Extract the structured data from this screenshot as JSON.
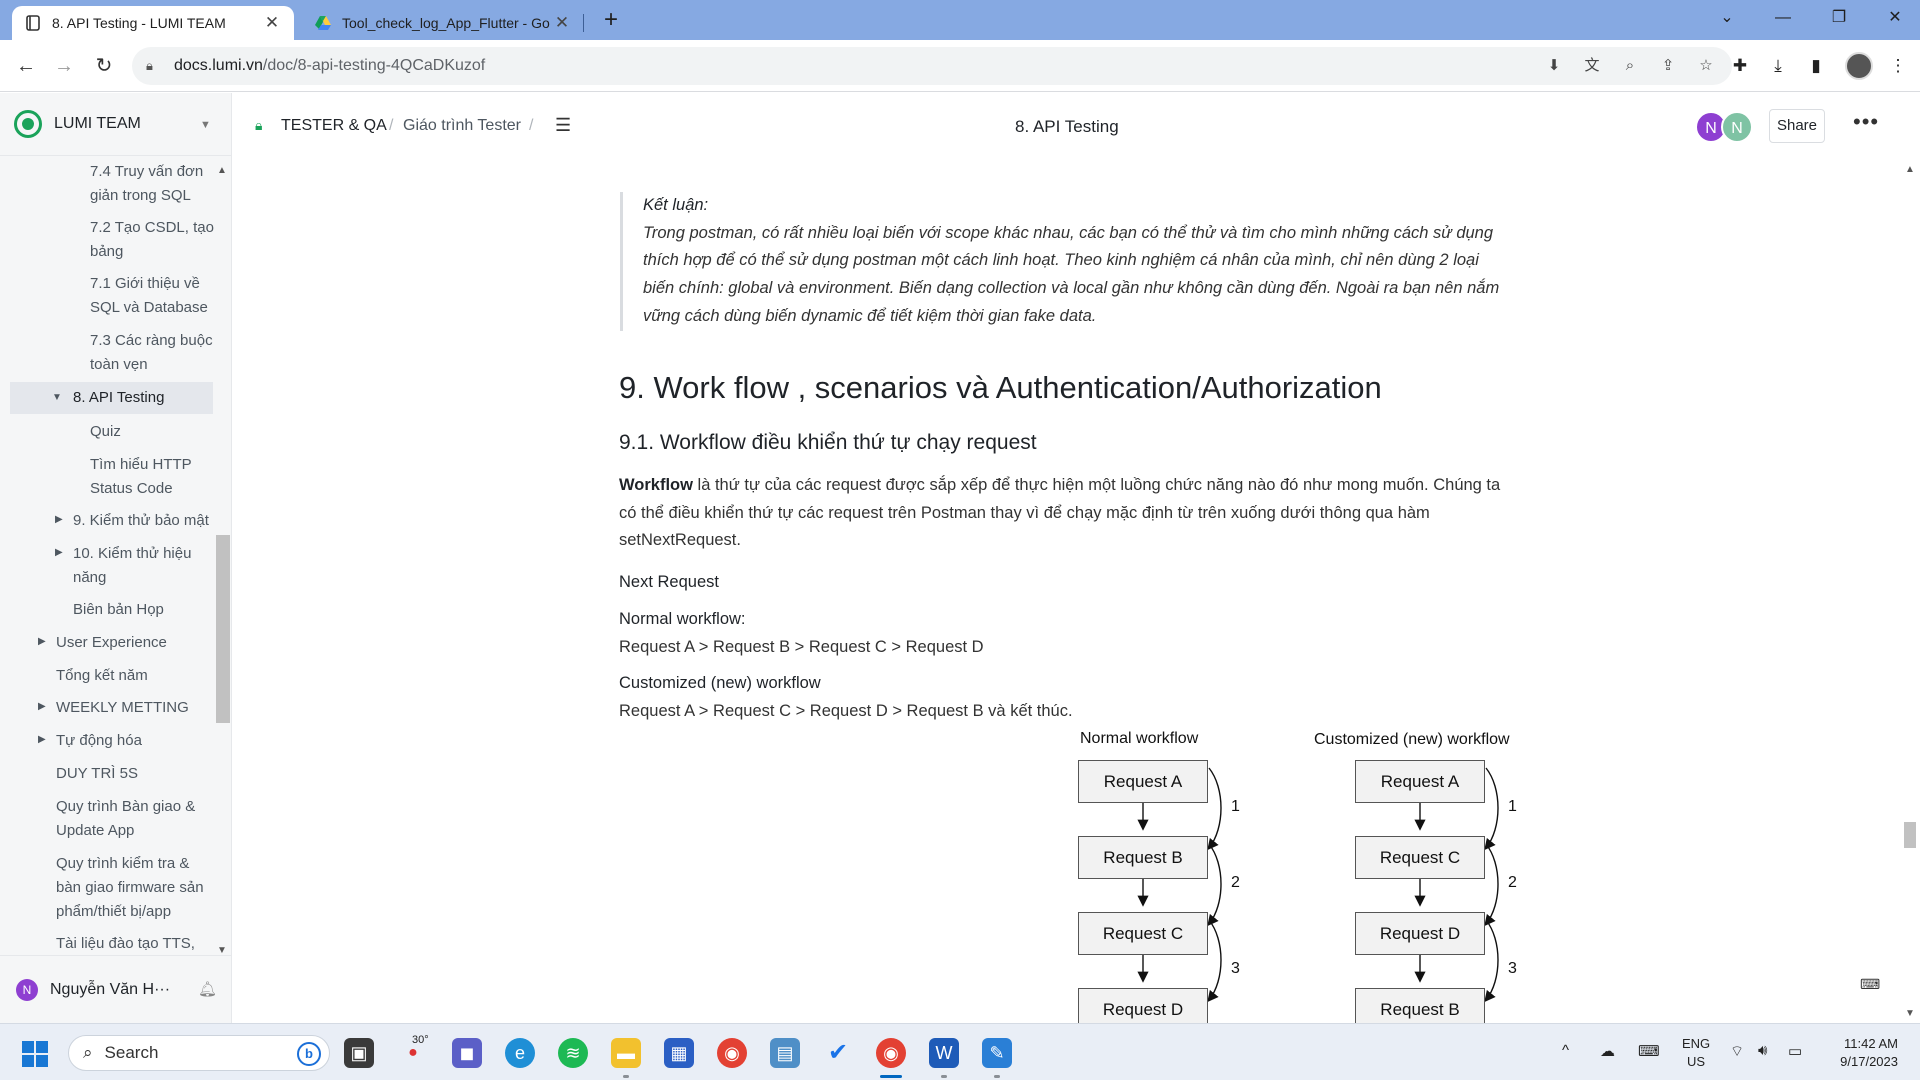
{
  "browser": {
    "tabs": [
      {
        "title": "8. API Testing - LUMI TEAM",
        "icon": "outline-doc-icon"
      },
      {
        "title": "Tool_check_log_App_Flutter - Go",
        "icon": "google-drive-icon"
      }
    ],
    "new_tab_label": "+",
    "url_host": "docs.lumi.vn",
    "url_path": "/doc/8-api-testing-4QCaDKuzof"
  },
  "sidebar": {
    "team_name": "LUMI TEAM",
    "items": [
      {
        "label": "7.4 Truy vấn đơn",
        "label2": "giản trong SQL"
      },
      {
        "label": "7.2 Tạo CSDL, tạo",
        "label2": "bảng"
      },
      {
        "label": "7.1 Giới thiệu về",
        "label2": "SQL và Database"
      },
      {
        "label": "7.3 Các ràng buộc",
        "label2": "toàn vẹn"
      },
      {
        "label": "8. API Testing"
      },
      {
        "label": "Quiz"
      },
      {
        "label": "Tìm hiểu HTTP",
        "label2": "Status Code"
      },
      {
        "label": "9. Kiểm thử bảo mật"
      },
      {
        "label": "10. Kiểm thử hiệu",
        "label2": "năng"
      },
      {
        "label": "Biên bản Họp"
      },
      {
        "label": "User Experience"
      },
      {
        "label": "Tổng kết năm"
      },
      {
        "label": "WEEKLY METTING"
      },
      {
        "label": "Tự động hóa"
      },
      {
        "label": "DUY TRÌ 5S"
      },
      {
        "label": "Quy trình Bàn giao &",
        "label2": "Update App"
      },
      {
        "label": "Quy trình kiểm tra &",
        "label2": "bàn giao firmware sản",
        "label3": "phẩm/thiết bị/app"
      },
      {
        "label": "Tài liệu đào tạo TTS,"
      }
    ],
    "user_initial": "N",
    "user_name": "Nguyễn Văn H···"
  },
  "header": {
    "breadcrumb_1": "TESTER & QA",
    "breadcrumb_2": "Giáo trình Tester",
    "title": "8. API Testing",
    "avatar_1": "N",
    "avatar_2": "N",
    "avatar_1_color": "#8e3fd1",
    "avatar_2_color": "#7fc3a4",
    "share_label": "Share",
    "more_label": "···"
  },
  "content": {
    "quote_title": "Kết luận:",
    "quote_body": "Trong postman, có rất nhiều loại biến với scope khác nhau, các bạn có thể thử và tìm cho mình những cách sử dụng thích hợp để có thể sử dụng postman một cách linh hoạt. Theo kinh nghiệm cá nhân của mình, chỉ nên dùng 2 loại biến chính: global và environment. Biến dạng collection và local gần như không cần dùng đến. Ngoài ra bạn nên nắm vững cách dùng biến dynamic để tiết kiệm thời gian fake data.",
    "h2": "9. Work flow , scenarios và Authentication/Authorization",
    "h3": "9.1. Workflow điều khiển thứ tự chạy request",
    "para_bold": "Workflow",
    "para_rest": " là thứ tự của các request được sắp xếp để thực hiện một luồng chức năng nào đó như mong muốn. Chúng ta có thể điều khiển thứ tự các request trên Postman thay vì để chạy mặc định từ trên xuống dưới thông qua hàm setNextRequest.",
    "next_request": "Next Request",
    "normal_label": "Normal workflow:",
    "normal_flow": "Request A > Request B > Request C > Request D",
    "custom_label": "Customized (new) workflow",
    "custom_flow": "Request A > Request C > Request D > Request B và kết thúc."
  },
  "diagram": {
    "left_title": "Normal workflow",
    "right_title": "Customized (new) workflow",
    "left_boxes": [
      "Request A",
      "Request B",
      "Request C",
      "Request D"
    ],
    "right_boxes": [
      "Request A",
      "Request C",
      "Request D",
      "Request B"
    ],
    "step_numbers": [
      "1",
      "2",
      "3"
    ]
  },
  "taskbar": {
    "search_label": "Search",
    "weather": "30°",
    "lang_1": "ENG",
    "lang_2": "US",
    "time": "11:42 AM",
    "date": "9/17/2023"
  }
}
